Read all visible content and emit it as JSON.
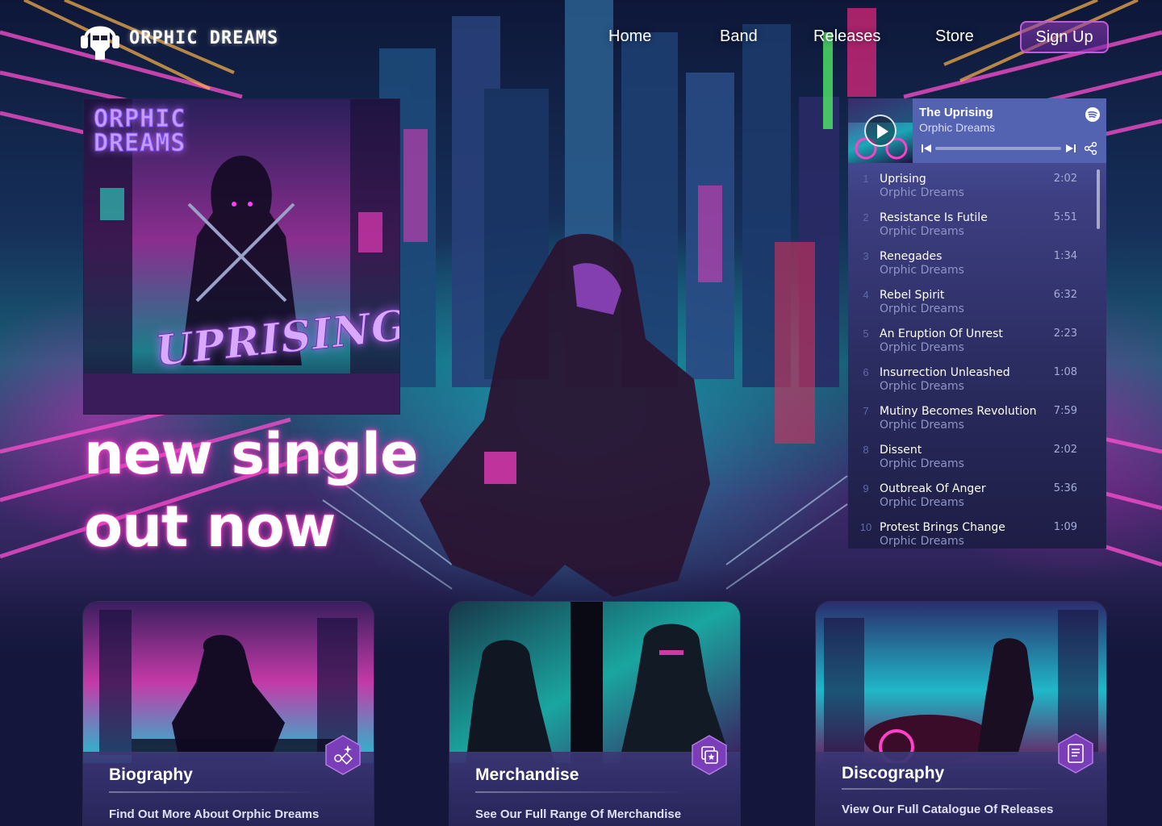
{
  "brand": {
    "name": "ORPHIC DREAMS",
    "accent": "#ff3fc8",
    "secondary": "#c25bd8"
  },
  "nav": {
    "items": [
      {
        "label": "Home"
      },
      {
        "label": "Band"
      },
      {
        "label": "Releases"
      },
      {
        "label": "Store"
      }
    ],
    "signup_label": "Sign Up"
  },
  "hero": {
    "cover_band": "ORPHIC DREAMS",
    "cover_title": "UPRISING",
    "headline_line1": "new single",
    "headline_line2": "out now"
  },
  "player": {
    "now_playing": {
      "title": "The Uprising",
      "artist": "Orphic Dreams"
    },
    "icons": [
      "play-icon",
      "spotify-icon",
      "previous-icon",
      "next-icon",
      "share-icon"
    ],
    "tracks": [
      {
        "num": "1",
        "title": "Uprising",
        "artist": "Orphic Dreams",
        "duration": "2:02"
      },
      {
        "num": "2",
        "title": "Resistance Is Futile",
        "artist": "Orphic Dreams",
        "duration": "5:51"
      },
      {
        "num": "3",
        "title": "Renegades",
        "artist": "Orphic Dreams",
        "duration": "1:34"
      },
      {
        "num": "4",
        "title": "Rebel Spirit",
        "artist": "Orphic Dreams",
        "duration": "6:32"
      },
      {
        "num": "5",
        "title": "An Eruption Of Unrest",
        "artist": "Orphic Dreams",
        "duration": "2:23"
      },
      {
        "num": "6",
        "title": "Insurrection Unleashed",
        "artist": "Orphic Dreams",
        "duration": "1:08"
      },
      {
        "num": "7",
        "title": "Mutiny Becomes Revolution",
        "artist": "Orphic Dreams",
        "duration": "7:59"
      },
      {
        "num": "8",
        "title": "Dissent",
        "artist": "Orphic Dreams",
        "duration": "2:02"
      },
      {
        "num": "9",
        "title": "Outbreak Of Anger",
        "artist": "Orphic Dreams",
        "duration": "5:36"
      },
      {
        "num": "10",
        "title": "Protest Brings Change",
        "artist": "Orphic Dreams",
        "duration": "1:09"
      }
    ]
  },
  "cards": [
    {
      "title": "Biography",
      "description": "Find Out More About Orphic Dreams",
      "icon": "sparkle-shapes-icon"
    },
    {
      "title": "Merchandise",
      "description": "See Our Full  Range Of Merchandise",
      "icon": "merch-icon"
    },
    {
      "title": "Discography",
      "description": "View Our Full Catalogue Of Releases",
      "icon": "book-icon"
    }
  ]
}
